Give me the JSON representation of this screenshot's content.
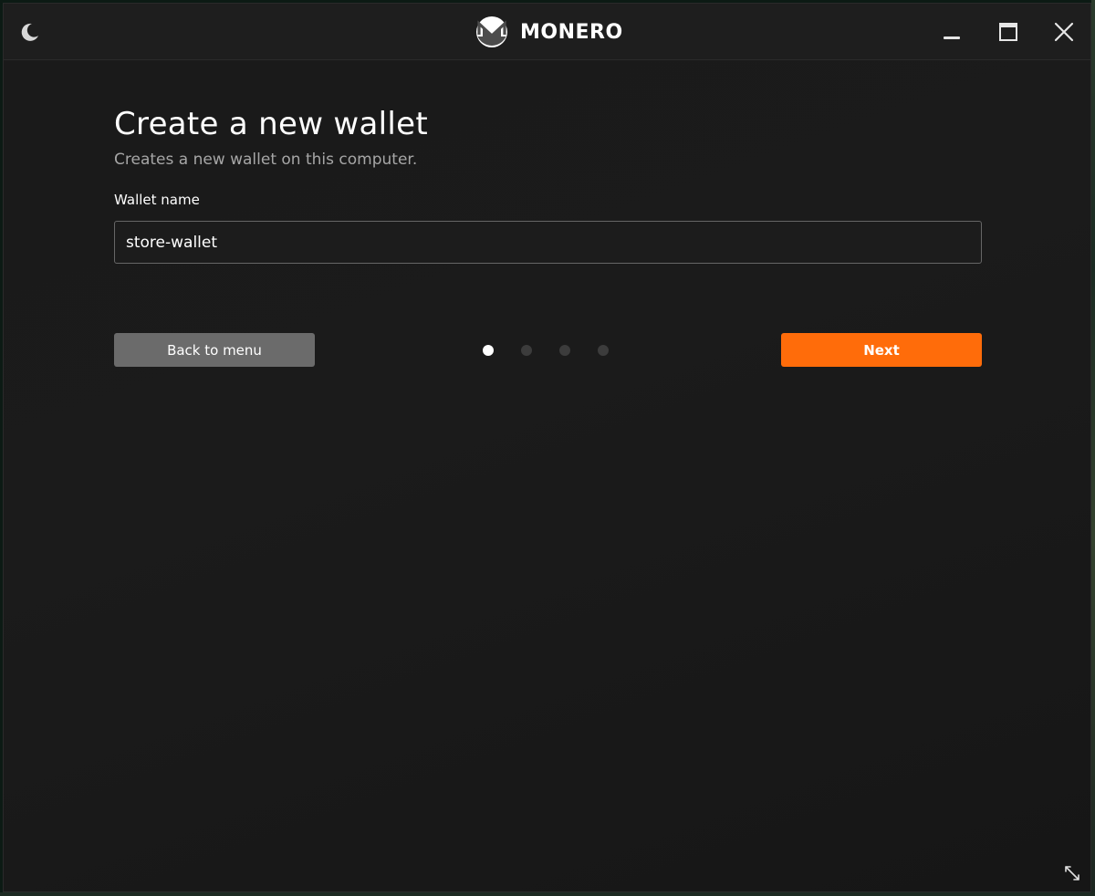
{
  "titlebar": {
    "app_name": "MONERO",
    "icons": {
      "theme": "moon-icon",
      "logo": "monero-logo-icon",
      "minimize": "minimize-icon",
      "maximize": "maximize-icon",
      "close": "close-icon"
    }
  },
  "page": {
    "title": "Create a new wallet",
    "subtitle": "Creates a new wallet on this computer.",
    "wallet_name_label": "Wallet name",
    "wallet_name_value": "store-wallet"
  },
  "navigation": {
    "back_label": "Back to menu",
    "next_label": "Next",
    "steps_total": 4,
    "step_current": 1
  },
  "colors": {
    "accent": "#ff6c0a",
    "background": "#1a1a1a",
    "back_button": "#6b6b6b",
    "dot_active": "#ffffff",
    "dot_inactive": "#3c3c3c"
  },
  "footer": {
    "resize_icon": "resize-diagonal-icon"
  }
}
